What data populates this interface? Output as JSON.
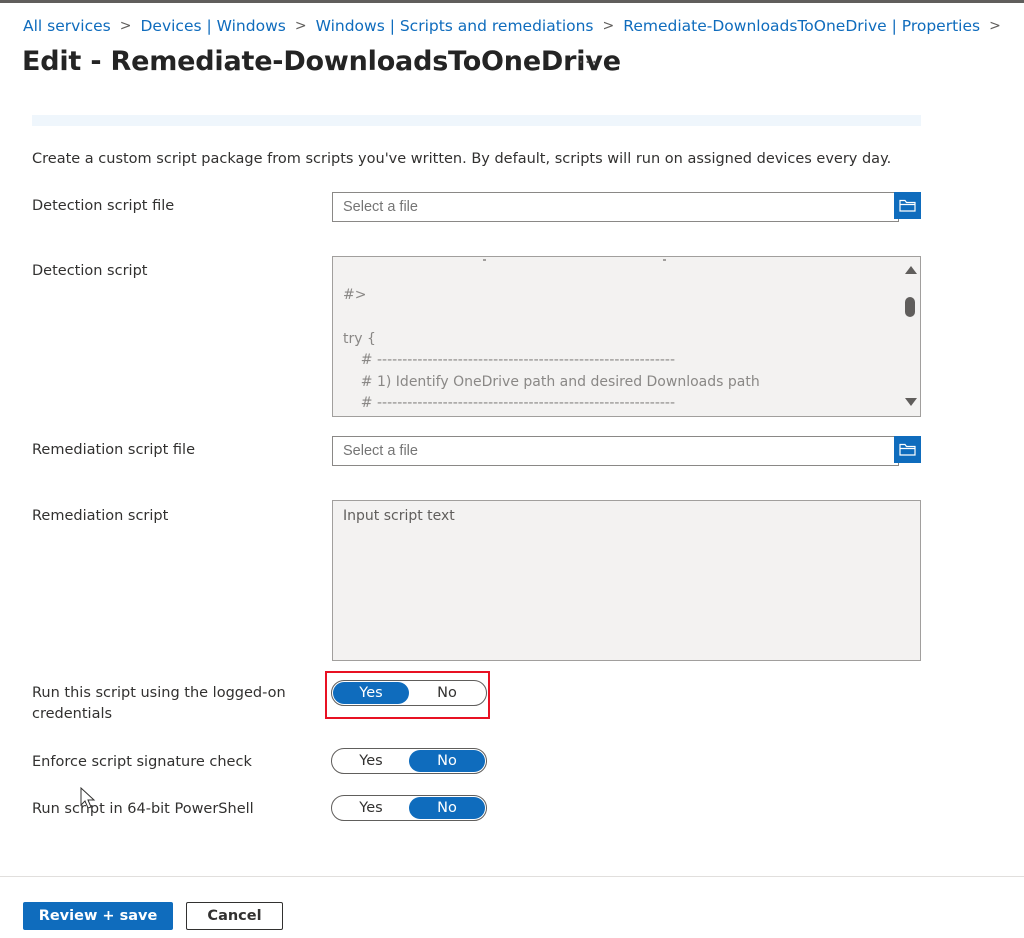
{
  "breadcrumb": [
    {
      "label": "All services"
    },
    {
      "label": "Devices | Windows"
    },
    {
      "label": "Windows | Scripts and remediations"
    },
    {
      "label": "Remediate-DownloadsToOneDrive | Properties"
    }
  ],
  "separator": ">",
  "page": {
    "title": "Edit - Remediate-DownloadsToOneDrive",
    "more_label": "···",
    "description": "Create a custom script package from scripts you've written. By default, scripts will run on assigned devices every day."
  },
  "form": {
    "detection_file": {
      "label": "Detection script file",
      "placeholder": "Select a file",
      "value": ""
    },
    "detection_script": {
      "label": "Detection script",
      "lines": [
        "#>",
        "",
        "try {",
        "    # -----------------------------------------------------------",
        "    # 1) Identify OneDrive path and desired Downloads path",
        "    # -----------------------------------------------------------"
      ]
    },
    "remediation_file": {
      "label": "Remediation script file",
      "placeholder": "Select a file",
      "value": ""
    },
    "remediation_script": {
      "label": "Remediation script",
      "placeholder": "Input script text",
      "value": ""
    },
    "logged_on": {
      "label_line1": "Run this script using the logged-on",
      "label_line2": "credentials",
      "selected": "Yes"
    },
    "signature_check": {
      "label": "Enforce script signature check",
      "selected": "No"
    },
    "powershell_64": {
      "label": "Run script in 64-bit PowerShell",
      "selected": "No"
    },
    "toggle_options": {
      "yes": "Yes",
      "no": "No"
    }
  },
  "footer": {
    "review_save": "Review + save",
    "cancel": "Cancel"
  },
  "icons": {
    "folder": "folder-icon",
    "scroll_up": "chevron-up-icon",
    "scroll_down": "chevron-down-icon",
    "pointer": "mouse-pointer-icon"
  },
  "colors": {
    "accent": "#0f6cbd",
    "highlight": "#e81123",
    "script_bg": "#f3f2f1"
  }
}
